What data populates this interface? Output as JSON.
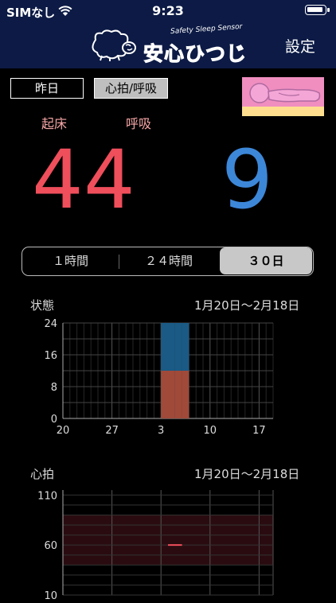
{
  "status_bar": {
    "carrier": "SIMなし",
    "time": "9:23"
  },
  "header": {
    "logo_text": "安心ひつじ",
    "logo_subtitle": "Safety Sleep Sensor",
    "settings_label": "設定"
  },
  "controls": {
    "yesterday_label": "昨日",
    "mode_label": "心拍/呼吸"
  },
  "metrics": {
    "wake_label": "起床",
    "breath_label": "呼吸",
    "left_value": "44",
    "right_value": "9",
    "left_color": "#ef4e5b",
    "right_color": "#3d87d8"
  },
  "segments": {
    "items": [
      "１時間",
      "２４時間",
      "３０日"
    ],
    "selected": "３０日"
  },
  "chart_data": [
    {
      "type": "bar",
      "title": "状態",
      "range": "1月20日～2月18日",
      "xticks": [
        "20",
        "27",
        "3",
        "10",
        "17"
      ],
      "ylim": [
        0,
        24
      ],
      "yticks": [
        "0",
        "8",
        "16",
        "24"
      ],
      "grid": true,
      "series": [
        {
          "values": [
            {
              "day": 14,
              "start": 0,
              "end": 12
            },
            {
              "day": 15,
              "start": 0,
              "end": 12
            },
            {
              "day": 16,
              "start": 0,
              "end": 12
            },
            {
              "day": 17,
              "start": 0,
              "end": 12
            }
          ],
          "color": "#a04a3a"
        },
        {
          "values": [
            {
              "day": 14,
              "start": 12,
              "end": 24
            },
            {
              "day": 15,
              "start": 12,
              "end": 24
            },
            {
              "day": 16,
              "start": 12,
              "end": 24
            },
            {
              "day": 17,
              "start": 12,
              "end": 24
            }
          ],
          "color": "#1a5a85"
        }
      ]
    },
    {
      "type": "line",
      "title": "心拍",
      "range": "1月20日～2月18日",
      "ylim": [
        10,
        115
      ],
      "yticks": [
        "110",
        "60",
        "10"
      ],
      "grid": true,
      "band": [
        40,
        90
      ],
      "series": [
        {
          "values": [
            {
              "day": 15,
              "value": 60
            },
            {
              "day": 17,
              "value": 60
            }
          ],
          "color": "#ef4e5b"
        }
      ]
    }
  ]
}
